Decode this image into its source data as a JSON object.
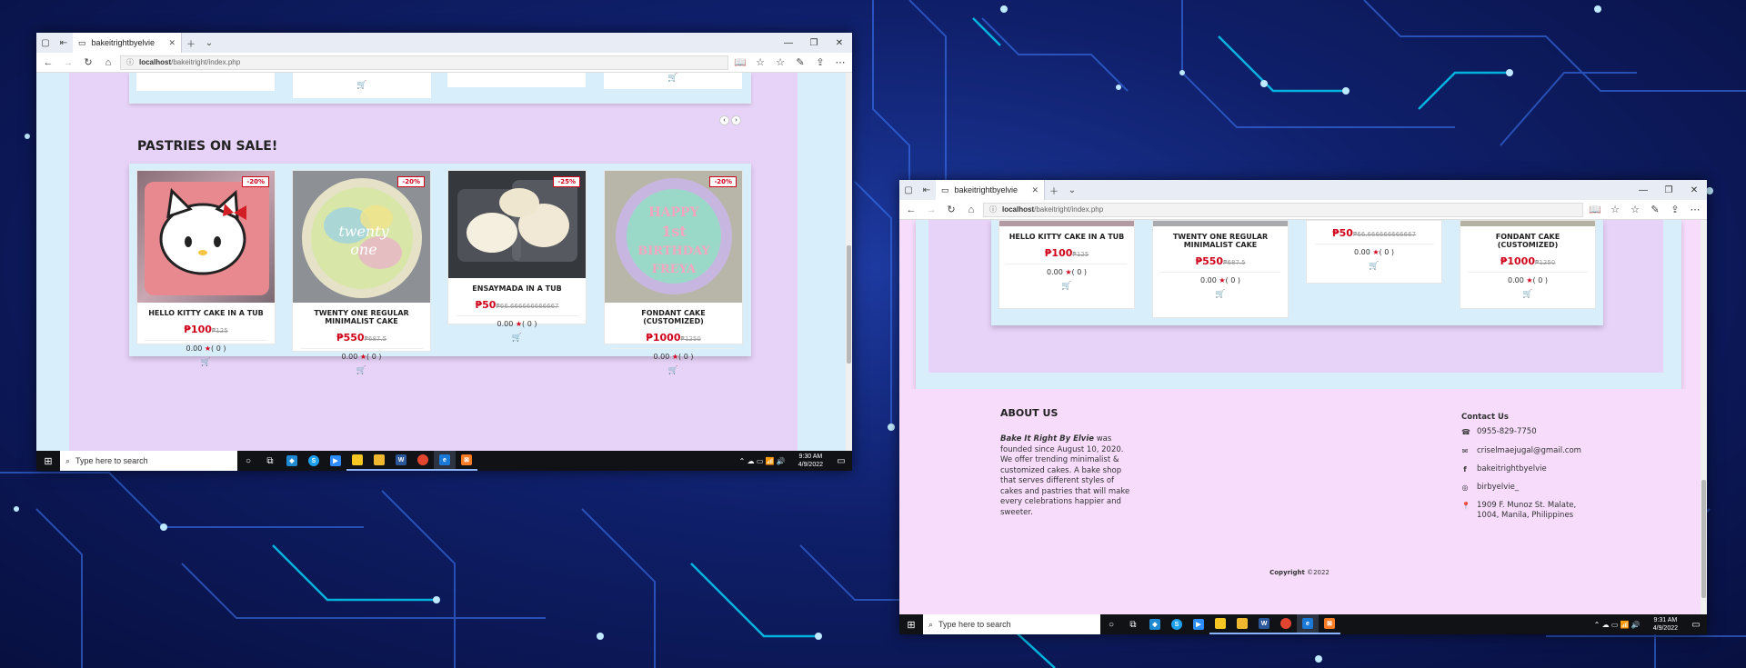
{
  "browser": {
    "tab_title": "bakeitrightbyelvie",
    "url_host": "localhost",
    "url_path": "/bakeitright/index.php"
  },
  "section": {
    "title": "PASTRIES ON SALE!"
  },
  "products": [
    {
      "name": "HELLO KITTY CAKE IN A TUB",
      "price": "₱100",
      "old_price": "₱125",
      "discount": "-20%",
      "rating": "0.00",
      "reviews": "( 0 )"
    },
    {
      "name": "TWENTY ONE REGULAR MINIMALIST CAKE",
      "price": "₱550",
      "old_price": "₱687.5",
      "discount": "-20%",
      "rating": "0.00",
      "reviews": "( 0 )"
    },
    {
      "name": "ENSAYMADA IN A TUB",
      "price": "₱50",
      "old_price": "₱66.666666666667",
      "discount": "-25%",
      "rating": "0.00",
      "reviews": "( 0 )"
    },
    {
      "name": "FONDANT CAKE (CUSTOMIZED)",
      "price": "₱1000",
      "old_price": "₱1250",
      "discount": "-20%",
      "rating": "0.00",
      "reviews": "( 0 )"
    }
  ],
  "footer": {
    "about_title": "ABOUT US",
    "about_brand": "Bake It Right By Elvie",
    "about_text": " was founded since August 10, 2020. We offer trending minimalist & customized cakes. A bake shop that serves different styles of cakes and pastries that will make every celebrations happier and sweeter.",
    "contact_title": "Contact Us",
    "phone": "0955-829-7750",
    "email": "criselmaejugal@gmail.com",
    "facebook": "bakeitrightbyelvie",
    "instagram": "birbyelvie_",
    "address": "1909 F. Munoz St. Malate, 1004, Manila, Philippines",
    "copyright_label": "Copyright",
    "copyright_year": "©2022"
  },
  "taskbar": {
    "search_placeholder": "Type here to search",
    "left_time": "9:30 AM",
    "left_date": "4/9/2022",
    "right_time": "9:31 AM",
    "right_date": "4/9/2022"
  },
  "icons": {
    "star": "★",
    "cart": "🛒"
  },
  "colors": {
    "accent_red": "#d0021b",
    "lilac": "#e8d3f8",
    "footer_bg": "#f7dcfc"
  }
}
